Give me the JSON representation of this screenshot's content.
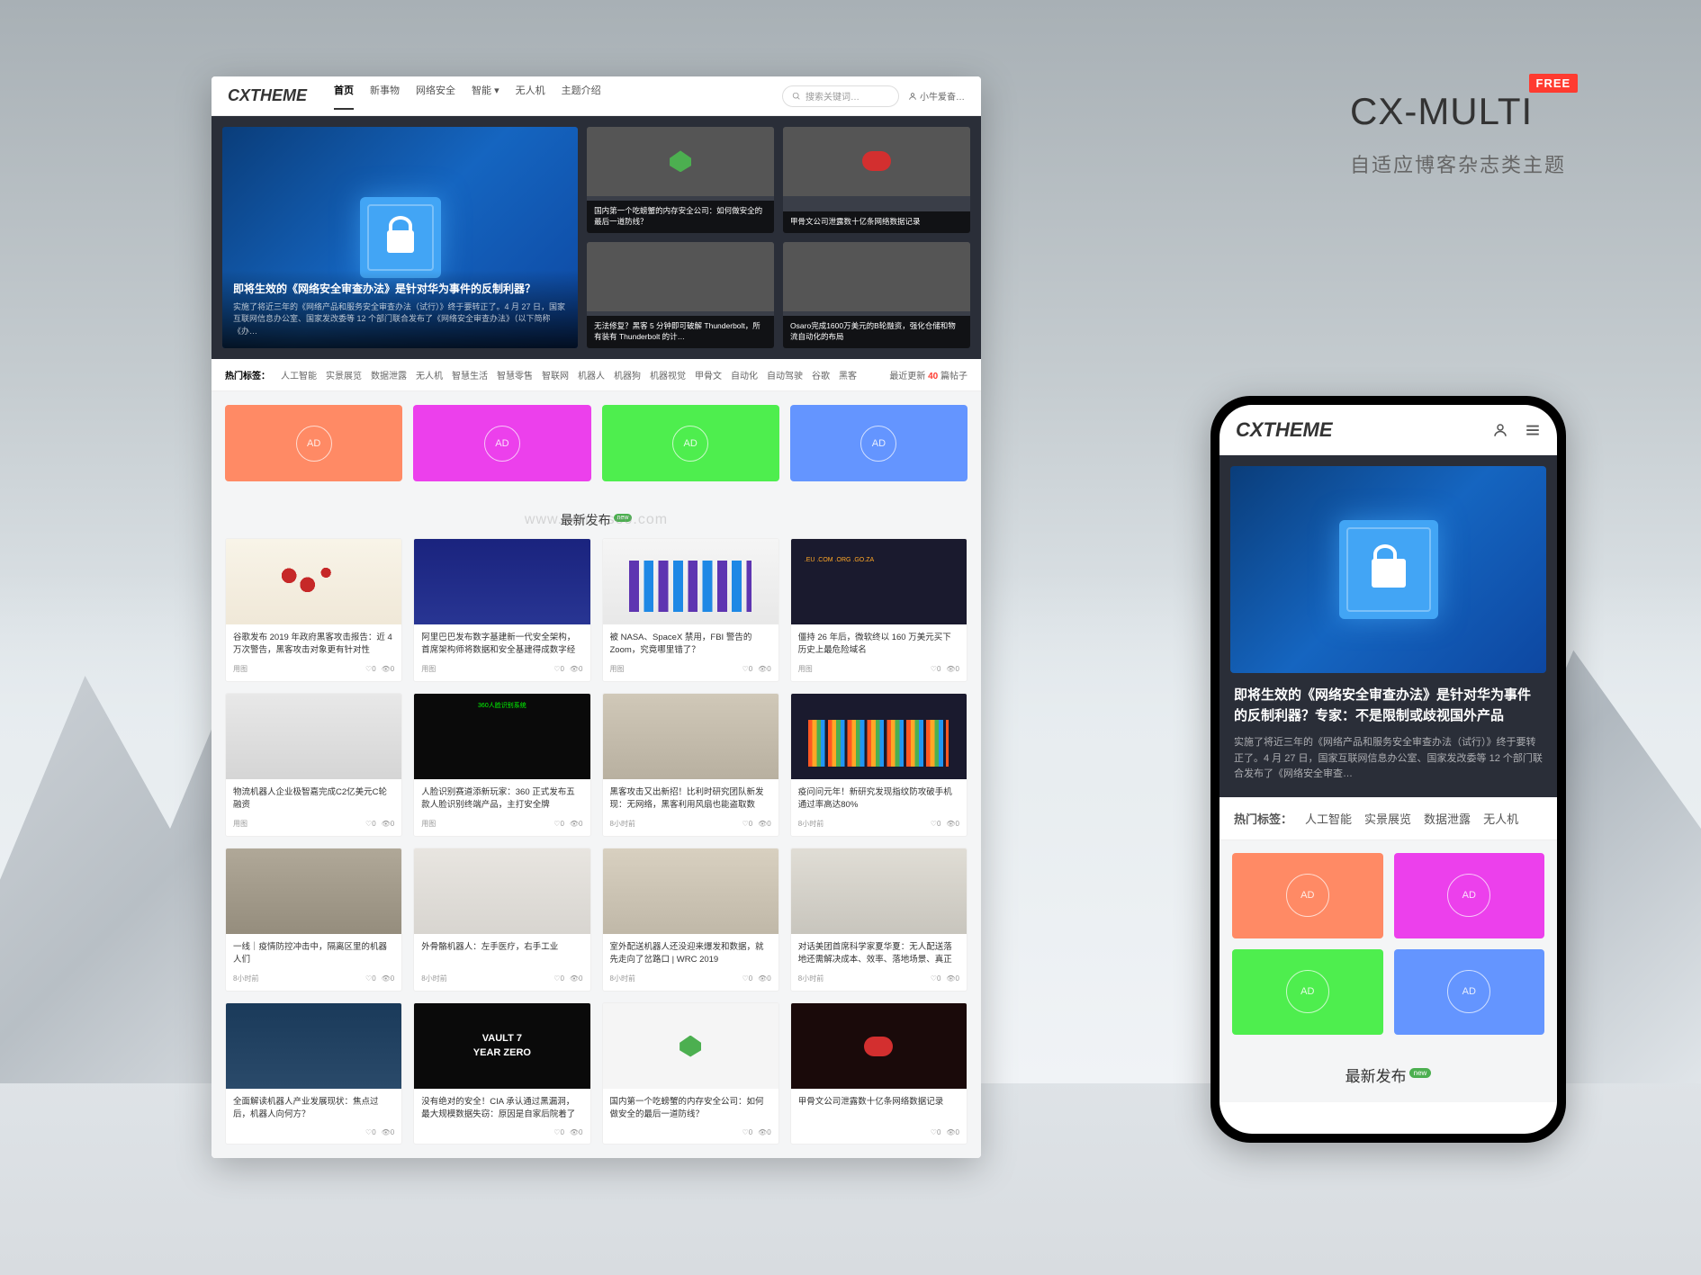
{
  "promo": {
    "title": "CX-MULTI",
    "badge": "FREE",
    "subtitle": "自适应博客杂志类主题"
  },
  "desktop": {
    "logo": "CXTHEME",
    "nav": [
      "首页",
      "新事物",
      "网络安全",
      "智能 ▾",
      "无人机",
      "主题介绍"
    ],
    "search_placeholder": "搜索关键词…",
    "user": "小牛爱奋…",
    "hero": {
      "main": {
        "title": "即将生效的《网络安全审查办法》是针对华为事件的反制利器？",
        "desc": "实施了将近三年的《网络产品和服务安全审查办法（试行）》终于要转正了。4 月 27 日，国家互联网信息办公室、国家发改委等 12 个部门联合发布了《网络安全审查办法》（以下简称《办…"
      },
      "tiles": [
        {
          "cap": "国内第一个吃螃蟹的内存安全公司：如何做安全的最后一道防线？"
        },
        {
          "cap": "甲骨文公司泄露数十亿条网络数据记录"
        },
        {
          "cap": "无法修复？黑客 5 分钟即可破解 Thunderbolt，所有装有 Thunderbolt 的计…"
        },
        {
          "cap": "Osaro完成1600万美元的B轮融资，强化仓储和物流自动化的布局"
        }
      ]
    },
    "tags": {
      "label": "热门标签：",
      "items": [
        "人工智能",
        "实景展览",
        "数据泄露",
        "无人机",
        "智慧生活",
        "智慧零售",
        "智联网",
        "机器人",
        "机器狗",
        "机器视觉",
        "甲骨文",
        "自动化",
        "自动驾驶",
        "谷歌",
        "黑客"
      ],
      "count_pre": "最近更新",
      "count_num": "40",
      "count_post": "篇帖子"
    },
    "ads": [
      "AD",
      "AD",
      "AD",
      "AD"
    ],
    "section_title": "最新发布",
    "section_badge": "new",
    "watermark": "www.henenseo.com",
    "cards": [
      {
        "title": "谷歌发布 2019 年政府黑客攻击报告：近 4 万次警告，黑客攻击对象更有针对性",
        "meta": "用图",
        "img": "img-map"
      },
      {
        "title": "阿里巴巴发布数字基建新一代安全架构，首席架构师将数据和安全基建得成数字经济标配",
        "meta": "用图",
        "img": "img-blue-chart"
      },
      {
        "title": "被 NASA、SpaceX 禁用，FBI 警告的 Zoom，究竟哪里错了？",
        "meta": "用图",
        "img": "img-bars"
      },
      {
        "title": "僵持 26 年后，微软终以 160 万美元买下历史上最危险域名",
        "meta": "用图",
        "img": "img-world"
      },
      {
        "title": "物流机器人企业极智嘉完成C2亿美元C轮融资",
        "meta": "用图",
        "img": "img-robots"
      },
      {
        "title": "人脸识别赛道添新玩家：360 正式发布五款人脸识别终端产品，主打安全牌",
        "meta": "用图",
        "img": "img-face"
      },
      {
        "title": "黑客攻击又出新招！比利时研究团队新发现：无网络，黑客利用风扇也能盗取数据！",
        "meta": "8小时前",
        "img": "img-laptop"
      },
      {
        "title": "疫问问元年！新研究发现指纹防攻破手机通过率高达80%",
        "meta": "8小时前",
        "img": "img-spectrum"
      },
      {
        "title": "一线｜疫情防控冲击中，隔离区里的机器人们",
        "meta": "8小时前",
        "img": "img-hall"
      },
      {
        "title": "外骨骼机器人：左手医疗，右手工业",
        "meta": "8小时前",
        "img": "img-chair"
      },
      {
        "title": "室外配送机器人还没迎来爆发和数据，就先走向了岔路口 | WRC 2019",
        "meta": "8小时前",
        "img": "img-delivery"
      },
      {
        "title": "对话美团首席科学家夏华夏：无人配送落地还需解决成本、效率、落地场景、真正核心需求痛点",
        "meta": "8小时前",
        "img": "img-expo"
      },
      {
        "title": "全面解读机器人产业发展现状：焦点过后，机器人向何方？",
        "meta": "",
        "img": "img-conf"
      },
      {
        "title": "没有绝对的安全！CIA 承认通过黑漏洞，最大规模数据失窃：原因是自家后院着了火",
        "meta": "",
        "img": "img-vault"
      },
      {
        "title": "国内第一个吃螃蟹的内存安全公司：如何做安全的最后一道防线？",
        "meta": "",
        "img": "img-anxin"
      },
      {
        "title": "甲骨文公司泄露数十亿条网络数据记录",
        "meta": "",
        "img": "img-oracle"
      }
    ]
  },
  "mobile": {
    "logo": "CXTHEME",
    "hero": {
      "title": "即将生效的《网络安全审查办法》是针对华为事件的反制利器？专家：不是限制或歧视国外产品",
      "desc": "实施了将近三年的《网络产品和服务安全审查办法（试行）》终于要转正了。4 月 27 日，国家互联网信息办公室、国家发改委等 12 个部门联合发布了《网络安全审查…"
    },
    "tags": {
      "label": "热门标签：",
      "items": [
        "人工智能",
        "实景展览",
        "数据泄露",
        "无人机"
      ]
    },
    "ads": [
      "AD",
      "AD",
      "AD",
      "AD"
    ],
    "section_title": "最新发布"
  },
  "meta_icons": {
    "like": "♡",
    "comment": "👁"
  }
}
